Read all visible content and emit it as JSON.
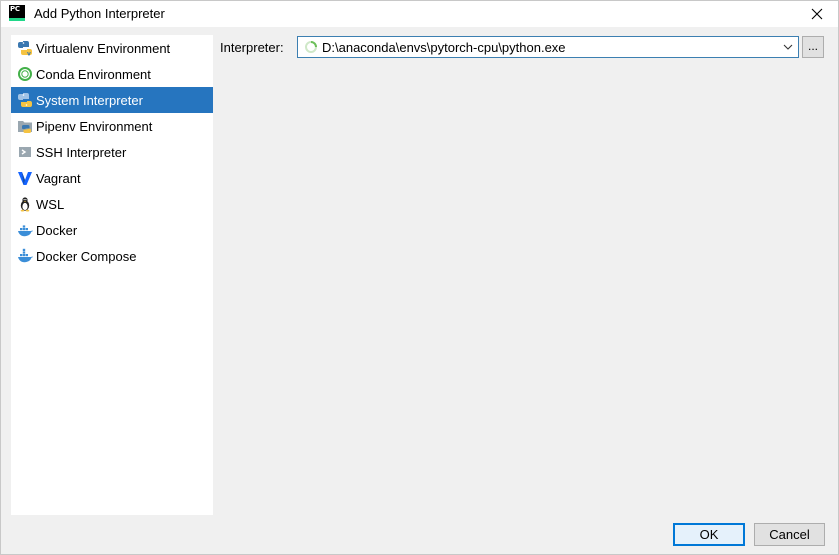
{
  "window": {
    "title": "Add Python Interpreter",
    "logo_text": "PC"
  },
  "sidebar": {
    "items": [
      {
        "label": "Virtualenv Environment",
        "icon": "virtualenv-icon",
        "selected": false
      },
      {
        "label": "Conda Environment",
        "icon": "conda-icon",
        "selected": false
      },
      {
        "label": "System Interpreter",
        "icon": "python-icon",
        "selected": true
      },
      {
        "label": "Pipenv Environment",
        "icon": "pipenv-icon",
        "selected": false
      },
      {
        "label": "SSH Interpreter",
        "icon": "ssh-icon",
        "selected": false
      },
      {
        "label": "Vagrant",
        "icon": "vagrant-icon",
        "selected": false
      },
      {
        "label": "WSL",
        "icon": "linux-penguin-icon",
        "selected": false
      },
      {
        "label": "Docker",
        "icon": "docker-icon",
        "selected": false
      },
      {
        "label": "Docker Compose",
        "icon": "docker-compose-icon",
        "selected": false
      }
    ]
  },
  "main": {
    "interpreter_label": "Interpreter:",
    "interpreter_value": "D:\\anaconda\\envs\\pytorch-cpu\\python.exe",
    "browse_label": "..."
  },
  "footer": {
    "ok_label": "OK",
    "cancel_label": "Cancel"
  },
  "colors": {
    "selection": "#2675bf",
    "accent": "#0078d7",
    "background": "#f0f0f0"
  }
}
